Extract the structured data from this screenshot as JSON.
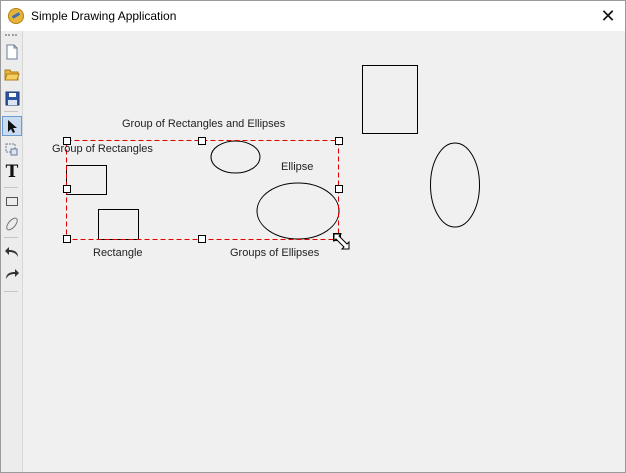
{
  "window": {
    "title": "Simple Drawing Application",
    "close_glyph": "✕"
  },
  "toolbar": {
    "items": [
      {
        "name": "new-file-icon"
      },
      {
        "name": "open-folder-icon"
      },
      {
        "name": "save-icon"
      },
      {
        "name": "select-arrow-icon",
        "selected": true
      },
      {
        "name": "group-select-icon"
      },
      {
        "name": "text-tool-icon",
        "glyph": "T"
      },
      {
        "name": "rectangle-tool-icon"
      },
      {
        "name": "ellipse-tool-icon"
      },
      {
        "name": "undo-icon"
      },
      {
        "name": "redo-icon"
      }
    ]
  },
  "canvas": {
    "labels": {
      "group_all": "Group of Rectangles and Ellipses",
      "group_rects": "Group of Rectangles",
      "ellipse": "Ellipse",
      "rectangle": "Rectangle",
      "group_ellipses": "Groups of Ellipses"
    }
  },
  "colors": {
    "selection": "#e00000",
    "canvas_bg": "#f0f0f0",
    "toolbar_selected": "#c9dcf2"
  }
}
